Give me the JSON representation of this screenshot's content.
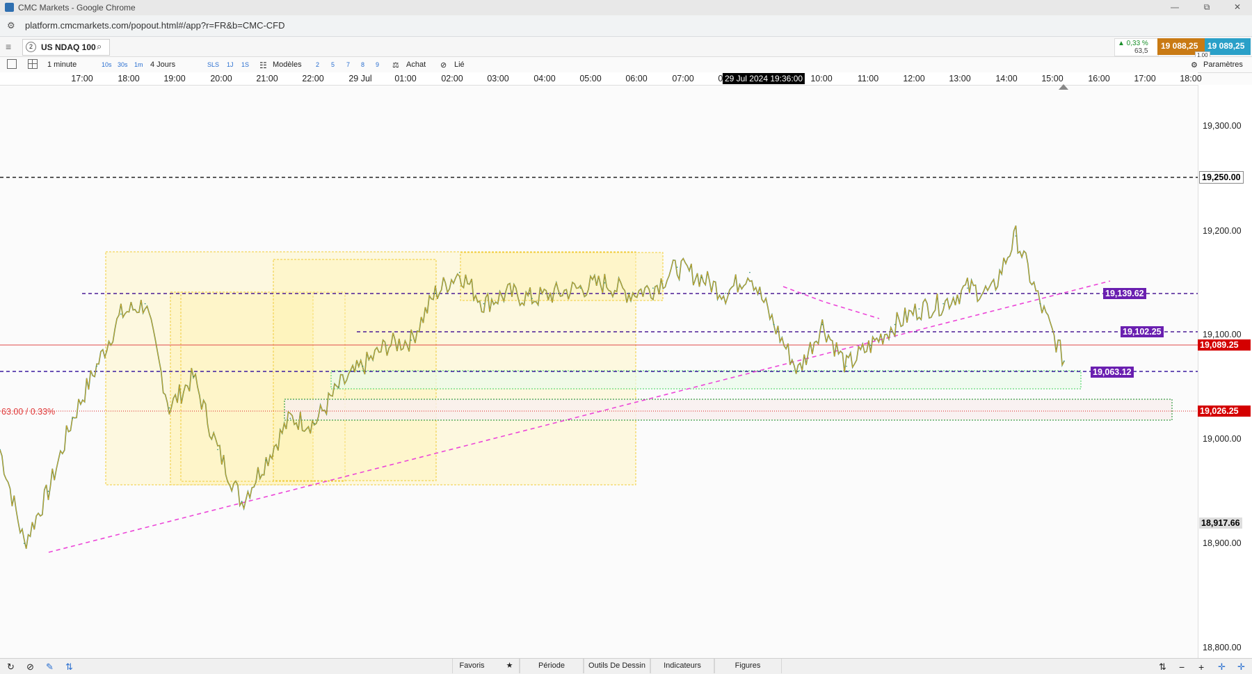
{
  "window": {
    "title": "CMC Markets - Google Chrome",
    "min": "—",
    "restore": "⧉",
    "close": "✕"
  },
  "address": {
    "url": "platform.cmcmarkets.com/popout.html#/app?r=FR&b=CMC-CFD",
    "tune_icon": "⚙"
  },
  "instrument": {
    "number": "2",
    "name": "US NDAQ 100",
    "change_pct": "▲ 0,33 %",
    "change_pts": "63,5",
    "sell_price": "19 088,25",
    "buy_price": "19 089,25",
    "spread": "1,00"
  },
  "toolbar": {
    "interval": "1 minute",
    "quick_intervals": [
      "10s",
      "30s",
      "1m"
    ],
    "range": "4 Jours",
    "tools": [
      "SLS",
      "1J",
      "1S"
    ],
    "templates": "Modèles",
    "numbers": [
      "2",
      "5",
      "7",
      "8",
      "9"
    ],
    "order_side": "Achat",
    "linked": "Lié",
    "settings": "Paramètres"
  },
  "time_axis": {
    "ticks": [
      "17:00",
      "18:00",
      "19:00",
      "20:00",
      "21:00",
      "22:00",
      "29 Jul",
      "01:00",
      "02:00",
      "03:00",
      "04:00",
      "05:00",
      "06:00",
      "07:00",
      "09:00",
      "10:00",
      "11:00",
      "12:00",
      "13:00",
      "14:00",
      "15:00",
      "16:00",
      "17:00",
      "18:00"
    ],
    "crosshair": "29 Jul 2024 19:36:00"
  },
  "chart_data": {
    "type": "line",
    "instrument": "US NDAQ 100",
    "interval": "1 minute",
    "x": [
      "16:30",
      "17:00",
      "17:30",
      "18:00",
      "18:30",
      "19:00",
      "19:30",
      "20:00",
      "20:30",
      "21:00",
      "21:30",
      "22:00",
      "22:30",
      "29 Jul",
      "00:30",
      "01:00",
      "01:30",
      "02:00",
      "02:30",
      "03:00",
      "03:30",
      "04:00",
      "04:30",
      "05:00",
      "05:30",
      "06:00",
      "06:30",
      "07:00",
      "07:30",
      "08:00",
      "08:30",
      "09:00",
      "09:30",
      "10:00",
      "10:30",
      "11:00",
      "11:30",
      "12:00",
      "12:30",
      "13:00",
      "13:30",
      "14:00",
      "14:30",
      "15:00",
      "15:10"
    ],
    "y": [
      19000,
      18910,
      18960,
      19030,
      19080,
      19130,
      19140,
      19040,
      19070,
      19000,
      18950,
      18990,
      19030,
      19025,
      19060,
      19080,
      19100,
      19105,
      19150,
      19170,
      19140,
      19150,
      19145,
      19150,
      19155,
      19160,
      19150,
      19155,
      19175,
      19165,
      19150,
      19170,
      19120,
      19075,
      19120,
      19080,
      19100,
      19120,
      19135,
      19140,
      19155,
      19150,
      19205,
      19140,
      19085
    ],
    "ylim": [
      18800,
      19350
    ],
    "yticks": [
      "19,300.00",
      "19,200.00",
      "19,100.00",
      "19,000.00",
      "18,900.00",
      "18,800.00"
    ],
    "levels": [
      {
        "label": "19,250.00",
        "color": "#ffffff",
        "text_color": "#000000"
      },
      {
        "label": "19,139.62",
        "color": "#6a1fb0"
      },
      {
        "label": "19,102.25",
        "color": "#6a1fb0"
      },
      {
        "label": "19,089.25",
        "color": "#d40000"
      },
      {
        "label": "19,063.12",
        "color": "#6a1fb0"
      },
      {
        "label": "19,026.25",
        "color": "#d40000"
      },
      {
        "label": "18,917.66",
        "color": "#dddddd",
        "text_color": "#000000"
      }
    ],
    "left_annotation": "63.00 / 0.33%"
  },
  "bottom": {
    "tabs": [
      "Favoris",
      "Période",
      "Outils De Dessin",
      "Indicateurs",
      "Figures"
    ],
    "star": "★",
    "icons_right": [
      "⇅",
      "−",
      "+",
      "✛",
      "✛"
    ]
  }
}
